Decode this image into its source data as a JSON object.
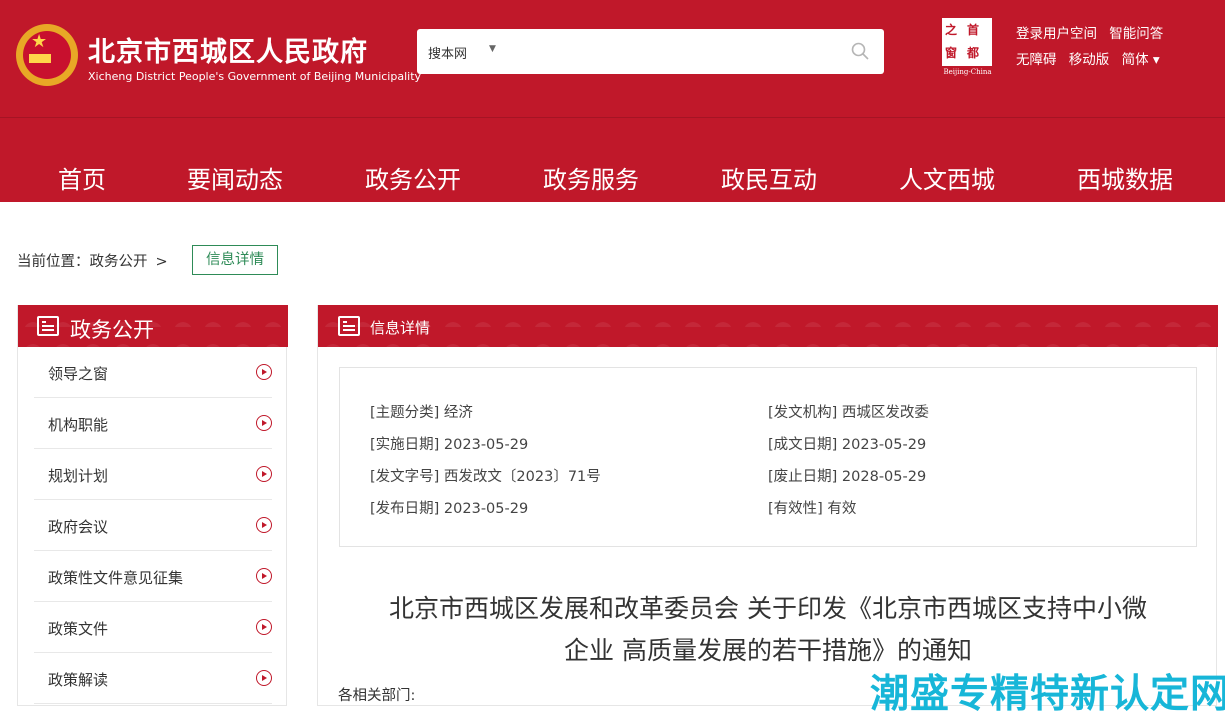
{
  "header": {
    "site_title": "北京市西城区人民政府",
    "site_subtitle": "Xicheng District People's Government of Beijing Municipality",
    "brand_mark": {
      "chars": [
        "之",
        "首",
        "窗",
        "都"
      ],
      "caption": "Beijing-China"
    },
    "search": {
      "scope": "搜本网",
      "placeholder": ""
    },
    "top_links": {
      "row1": [
        "登录用户空间",
        "智能问答"
      ],
      "row2": [
        "无障碍",
        "移动版",
        "简体 ▾"
      ]
    },
    "brand_color": "#c0182a"
  },
  "nav": [
    "首页",
    "要闻动态",
    "政务公开",
    "政务服务",
    "政民互动",
    "人文西城",
    "西城数据"
  ],
  "breadcrumb": {
    "prefix": "当前位置：",
    "parent": "政务公开",
    "separator": ">",
    "current": "信息详情"
  },
  "sidebar": {
    "title": "政务公开",
    "items": [
      "领导之窗",
      "机构职能",
      "规划计划",
      "政府会议",
      "政策性文件意见征集",
      "政策文件",
      "政策解读"
    ]
  },
  "main": {
    "title": "信息详情",
    "meta": {
      "topic": "[主题分类] 经济",
      "issuer": "[发文机构] 西城区发改委",
      "effective_date": "[实施日期] 2023-05-29",
      "written_date": "[成文日期] 2023-05-29",
      "doc_number": "[发文字号] 西发改文〔2023〕71号",
      "expiry_date": "[废止日期] 2028-05-29",
      "publish_date": "[发布日期] 2023-05-29",
      "validity": "[有效性] 有效"
    },
    "doc_title_line1": "北京市西城区发展和改革委员会 关于印发《北京市西城区支持中小微",
    "doc_title_line2": "企业 高质量发展的若干措施》的通知",
    "salutation": "各相关部门:"
  },
  "watermark": "潮盛专精特新认定网"
}
